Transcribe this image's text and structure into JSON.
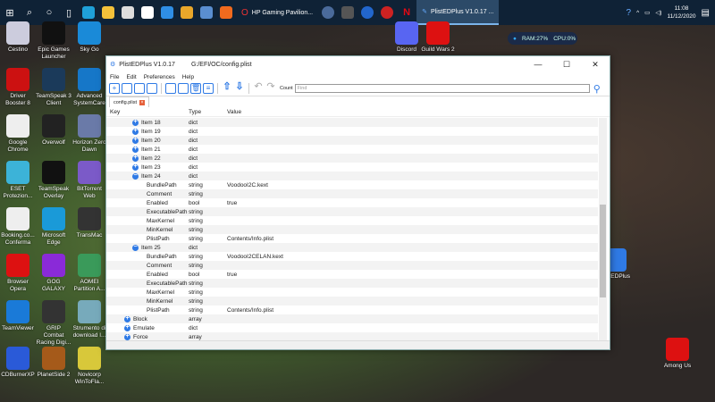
{
  "taskbar": {
    "apps": [
      {
        "icon": "edge-icon",
        "color": "#1fa0d8"
      },
      {
        "icon": "file-explorer-icon",
        "color": "#f3c13a"
      },
      {
        "icon": "store-icon",
        "color": "#ddd"
      },
      {
        "icon": "amazon-icon",
        "color": "#fff"
      },
      {
        "icon": "mail-icon",
        "color": "#2f8ee5"
      },
      {
        "icon": "chrome-icon",
        "color": "#e9a72a"
      },
      {
        "icon": "steam-icon",
        "color": "#5a8ed0"
      },
      {
        "icon": "origin-icon",
        "color": "#f06a1e"
      }
    ],
    "opera_task": "HP Gaming Pavilion...",
    "plist_task": "PlistEDPlus V1.0.17 ...",
    "time": "11:08",
    "date": "11/12/2020"
  },
  "desktop": {
    "icons": [
      "Cestino",
      "Epic Games Launcher",
      "Sky Go",
      "Driver Booster 8",
      "TeamSpeak 3 Client",
      "Advanced SystemCare",
      "Google Chrome",
      "Overwolf",
      "Horizon Zero Dawn",
      "ESET Protezion...",
      "TeamSpeak Overlay",
      "BitTorrent Web",
      "Booking.co... Conferma",
      "Microsoft Edge",
      "TransMac",
      "Browser Opera",
      "GOG GALAXY",
      "AOMEI Partition A...",
      "TeamViewer",
      "GRIP Combat Racing Digi...",
      "Strumento di download I...",
      "CDBurnerXP",
      "PlanetSide 2",
      "Novicorp WinToFla...",
      "Discord",
      "Guild Wars 2",
      "PlistEDPlus",
      "Among Us"
    ],
    "colors": [
      "#ccd",
      "#111",
      "#1a8ad8",
      "#c11",
      "#1b3a5a",
      "#1677c8",
      "#eee",
      "#222",
      "#6a7aa8",
      "#3cb3d8",
      "#111",
      "#7b5ac8",
      "#eee",
      "#1a9ad8",
      "#333",
      "#d11",
      "#8a2ad8",
      "#3a9a5a",
      "#1a7ad8",
      "#333",
      "#7ab",
      "#2a5ad8",
      "#a55a1a",
      "#d8c83a",
      "#5865f2",
      "#d11",
      "#2f7ae5",
      "#d11"
    ]
  },
  "widget": {
    "ram": "RAM:27%",
    "cpu": "CPU:0%"
  },
  "window": {
    "app": "PlistEDPlus V1.0.17",
    "path": "G:/EFI/OC/config.plist",
    "menu": [
      "File",
      "Edit",
      "Preferences",
      "Help"
    ],
    "count_label": "Count",
    "find_placeholder": "Find",
    "tab": "config.plist",
    "columns": [
      "Key",
      "Type",
      "Value"
    ],
    "rows": [
      {
        "k": "Item 18",
        "t": "dict",
        "v": "",
        "lvl": 1,
        "ex": "+"
      },
      {
        "k": "Item 19",
        "t": "dict",
        "v": "",
        "lvl": 1,
        "ex": "+"
      },
      {
        "k": "Item 20",
        "t": "dict",
        "v": "",
        "lvl": 1,
        "ex": "+"
      },
      {
        "k": "Item 21",
        "t": "dict",
        "v": "",
        "lvl": 1,
        "ex": "+"
      },
      {
        "k": "Item 22",
        "t": "dict",
        "v": "",
        "lvl": 1,
        "ex": "+"
      },
      {
        "k": "Item 23",
        "t": "dict",
        "v": "",
        "lvl": 1,
        "ex": "+"
      },
      {
        "k": "Item 24",
        "t": "dict",
        "v": "",
        "lvl": 1,
        "ex": "-"
      },
      {
        "k": "BundlePath",
        "t": "string",
        "v": "VoodooI2C.kext",
        "lvl": 2
      },
      {
        "k": "Comment",
        "t": "string",
        "v": "",
        "lvl": 2
      },
      {
        "k": "Enabled",
        "t": "bool",
        "v": "true",
        "lvl": 2
      },
      {
        "k": "ExecutablePath",
        "t": "string",
        "v": "",
        "lvl": 2
      },
      {
        "k": "MaxKernel",
        "t": "string",
        "v": "",
        "lvl": 2
      },
      {
        "k": "MinKernel",
        "t": "string",
        "v": "",
        "lvl": 2
      },
      {
        "k": "PlistPath",
        "t": "string",
        "v": "Contents/Info.plist",
        "lvl": 2
      },
      {
        "k": "Item 25",
        "t": "dict",
        "v": "",
        "lvl": 1,
        "ex": "-"
      },
      {
        "k": "BundlePath",
        "t": "string",
        "v": "VoodooI2CELAN.kext",
        "lvl": 2
      },
      {
        "k": "Comment",
        "t": "string",
        "v": "",
        "lvl": 2
      },
      {
        "k": "Enabled",
        "t": "bool",
        "v": "true",
        "lvl": 2
      },
      {
        "k": "ExecutablePath",
        "t": "string",
        "v": "",
        "lvl": 2
      },
      {
        "k": "MaxKernel",
        "t": "string",
        "v": "",
        "lvl": 2
      },
      {
        "k": "MinKernel",
        "t": "string",
        "v": "",
        "lvl": 2
      },
      {
        "k": "PlistPath",
        "t": "string",
        "v": "Contents/Info.plist",
        "lvl": 2
      },
      {
        "k": "Block",
        "t": "array",
        "v": "",
        "lvl": 0,
        "ex": "+"
      },
      {
        "k": "Emulate",
        "t": "dict",
        "v": "",
        "lvl": 0,
        "ex": "+"
      },
      {
        "k": "Force",
        "t": "array",
        "v": "",
        "lvl": 0,
        "ex": "+"
      }
    ]
  }
}
